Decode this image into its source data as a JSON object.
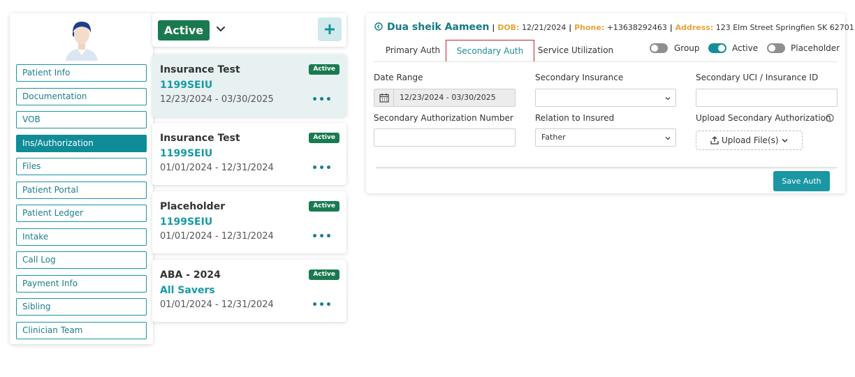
{
  "colors": {
    "accent": "#0f8c98",
    "badge_green": "#1a7a4f",
    "label_orange": "#e8a33a",
    "tab_outline_red": "#c0272d"
  },
  "sidebar": {
    "avatar_icon": "user-avatar-icon",
    "items": [
      {
        "label": "Patient Info",
        "active": false
      },
      {
        "label": "Documentation",
        "active": false
      },
      {
        "label": "VOB",
        "active": false
      },
      {
        "label": "Ins/Authorization",
        "active": true
      },
      {
        "label": "Files",
        "active": false
      },
      {
        "label": "Patient Portal",
        "active": false
      },
      {
        "label": "Patient Ledger",
        "active": false
      },
      {
        "label": "Intake",
        "active": false
      },
      {
        "label": "Call Log",
        "active": false
      },
      {
        "label": "Payment Info",
        "active": false
      },
      {
        "label": "Sibling",
        "active": false
      },
      {
        "label": "Clinician Team",
        "active": false
      }
    ]
  },
  "auth_list": {
    "filter_label": "Active",
    "add_icon": "plus-icon",
    "cards": [
      {
        "title": "Insurance Test",
        "payer": "1199SEIU",
        "dates": "12/23/2024 - 03/30/2025",
        "status": "Active",
        "selected": true
      },
      {
        "title": "Insurance Test",
        "payer": "1199SEIU",
        "dates": "01/01/2024 - 12/31/2024",
        "status": "Active",
        "selected": false
      },
      {
        "title": "Placeholder",
        "payer": "1199SEIU",
        "dates": "01/01/2024 - 12/31/2024",
        "status": "Active",
        "selected": false
      },
      {
        "title": "ABA - 2024",
        "payer": "All Savers",
        "dates": "01/01/2024 - 12/31/2024",
        "status": "Active",
        "selected": false
      }
    ],
    "more_glyph": "•••"
  },
  "patient": {
    "name": "Dua sheik Aameen",
    "dob_label": "DOB:",
    "dob": "12/21/2024",
    "phone_label": "Phone:",
    "phone": "+13638292463",
    "address_label": "Address:",
    "address": "123 Elm Street Springfien SK 62701"
  },
  "tabs": [
    {
      "label": "Primary Auth",
      "active": false
    },
    {
      "label": "Secondary Auth",
      "active": true
    },
    {
      "label": "Service Utilization",
      "active": false
    }
  ],
  "toggles": [
    {
      "label": "Group",
      "on": false
    },
    {
      "label": "Active",
      "on": true
    },
    {
      "label": "Placeholder",
      "on": false
    }
  ],
  "form": {
    "date_range_label": "Date Range",
    "date_range_value": "12/23/2024 - 03/30/2025",
    "secondary_insurance_label": "Secondary Insurance",
    "secondary_insurance_value": "",
    "secondary_uci_label": "Secondary UCI / Insurance ID",
    "secondary_uci_value": "",
    "secondary_auth_number_label": "Secondary Authorization Number",
    "secondary_auth_number_value": "",
    "relation_label": "Relation to Insured",
    "relation_value": "Father",
    "upload_label": "Upload Secondary Authorization",
    "upload_button": "Upload File(s)",
    "save_button": "Save Auth"
  }
}
